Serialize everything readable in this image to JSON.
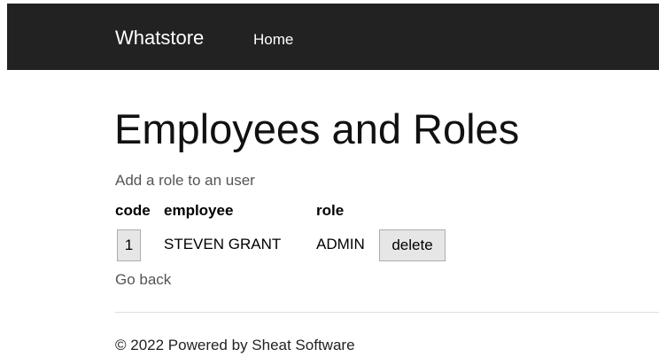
{
  "navbar": {
    "brand": "Whatstore",
    "links": [
      "Home"
    ]
  },
  "main": {
    "title": "Employees and Roles",
    "subtitle_link": "Add a role to an user",
    "table": {
      "headers": [
        "code",
        "employee",
        "role"
      ],
      "rows": [
        {
          "code": "1",
          "employee": "STEVEN GRANT",
          "role": "ADMIN",
          "action": "delete"
        }
      ]
    },
    "back_link": "Go back"
  },
  "footer": {
    "text": "© 2022 Powered by Sheat Software"
  },
  "colors": {
    "navbar_bg": "#222222",
    "button_bg": "#e6e6e6",
    "link_gray": "#555555"
  }
}
